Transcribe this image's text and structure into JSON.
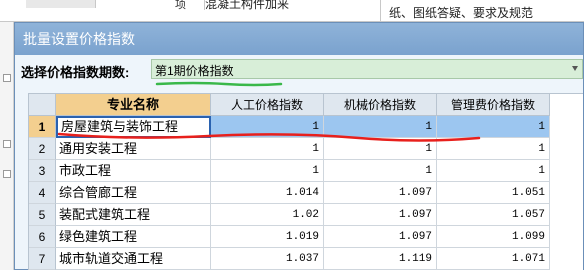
{
  "background": {
    "unit": "项",
    "name_fragment": "混凝土构件加来",
    "desc_line1": "纸、图纸答疑、要求及规范",
    "desc_line2": "",
    "desc_fragment": "纸、图纸答疑、要求及规范"
  },
  "dialog": {
    "title": "批量设置价格指数",
    "period_label": "选择价格指数期数:",
    "period_value": "第1期价格指数"
  },
  "table": {
    "headers": {
      "name": "专业名称",
      "labor": "人工价格指数",
      "machine": "机械价格指数",
      "mgmt": "管理费价格指数"
    },
    "rows": [
      {
        "no": "1",
        "name": "房屋建筑与装饰工程",
        "labor": "1",
        "machine": "1",
        "mgmt": "1"
      },
      {
        "no": "2",
        "name": "通用安装工程",
        "labor": "1",
        "machine": "1",
        "mgmt": "1"
      },
      {
        "no": "3",
        "name": "市政工程",
        "labor": "1",
        "machine": "1",
        "mgmt": "1"
      },
      {
        "no": "4",
        "name": "综合管廊工程",
        "labor": "1.014",
        "machine": "1.097",
        "mgmt": "1.051"
      },
      {
        "no": "5",
        "name": "装配式建筑工程",
        "labor": "1.02",
        "machine": "1.097",
        "mgmt": "1.057"
      },
      {
        "no": "6",
        "name": "绿色建筑工程",
        "labor": "1.019",
        "machine": "1.097",
        "mgmt": "1.099"
      },
      {
        "no": "7",
        "name": "城市轨道交通工程",
        "labor": "1.037",
        "machine": "1.119",
        "mgmt": "1.071"
      }
    ]
  },
  "colors": {
    "title_bar": "#7aa2ce",
    "header_name_bg": "#f3cf8f",
    "selection_bg": "#9cc6f0",
    "period_bg": "#d8eed8",
    "annotation_red": "#e8201c",
    "annotation_green": "#3ab84a"
  }
}
